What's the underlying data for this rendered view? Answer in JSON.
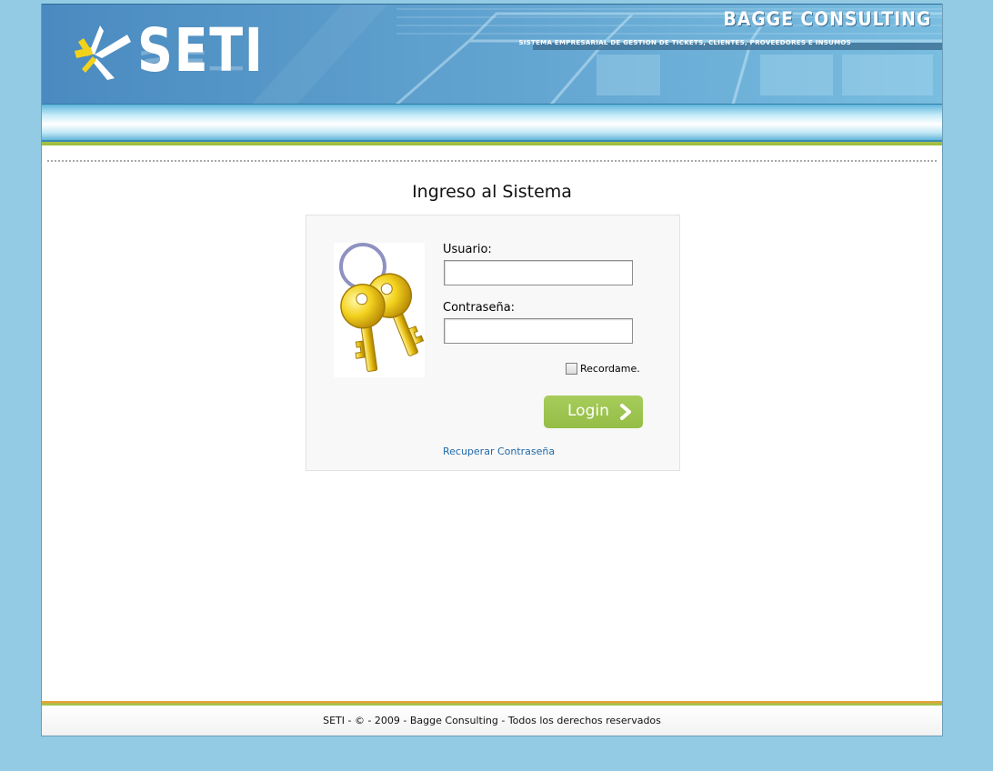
{
  "header": {
    "logo_text": "SETI",
    "brand_name": "BAGGE CONSULTING",
    "brand_subtitle": "SISTEMA EMPRESARIAL DE GESTION DE TICKETS, CLIENTES, PROVEEDORES E INSUMOS"
  },
  "login": {
    "title": "Ingreso al Sistema",
    "username_label": "Usuario:",
    "username_value": "",
    "password_label": "Contraseña:",
    "password_value": "",
    "remember_label": "Recordame.",
    "remember_checked": false,
    "login_button_label": "Login",
    "recover_link": "Recuperar Contraseña",
    "image_icon": "keys-icon"
  },
  "footer": {
    "text": "SETI - © - 2009 - Bagge Consulting - Todos los derechos reservados"
  },
  "colors": {
    "background": "#92cbe3",
    "accent_green": "#9bbb3c",
    "link_blue": "#2169a8",
    "banner_blue": "#4e8fbe"
  }
}
